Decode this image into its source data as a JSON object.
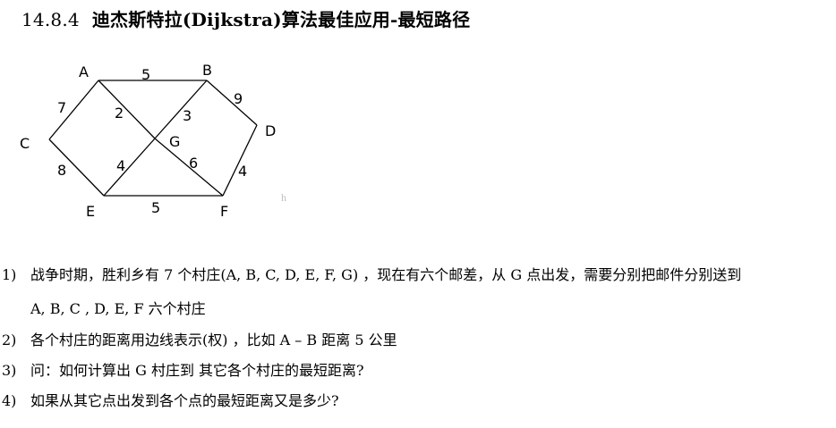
{
  "section": {
    "number": "14.8.4",
    "title": "迪杰斯特拉(Dijkstra)算法最佳应用-最短路径"
  },
  "graph": {
    "nodes": [
      {
        "id": "A",
        "label": "A"
      },
      {
        "id": "B",
        "label": "B"
      },
      {
        "id": "C",
        "label": "C"
      },
      {
        "id": "D",
        "label": "D"
      },
      {
        "id": "E",
        "label": "E"
      },
      {
        "id": "F",
        "label": "F"
      },
      {
        "id": "G",
        "label": "G"
      }
    ],
    "edges": [
      {
        "from": "A",
        "to": "B",
        "weight": "5"
      },
      {
        "from": "A",
        "to": "C",
        "weight": "7"
      },
      {
        "from": "A",
        "to": "G",
        "weight": "2"
      },
      {
        "from": "B",
        "to": "G",
        "weight": "3"
      },
      {
        "from": "B",
        "to": "D",
        "weight": "9"
      },
      {
        "from": "C",
        "to": "E",
        "weight": "8"
      },
      {
        "from": "E",
        "to": "G",
        "weight": "4"
      },
      {
        "from": "G",
        "to": "F",
        "weight": "6"
      },
      {
        "from": "D",
        "to": "F",
        "weight": "4"
      },
      {
        "from": "E",
        "to": "F",
        "weight": "5"
      }
    ],
    "watermark": "h"
  },
  "list": [
    {
      "idx": "1)",
      "text": "战争时期，胜利乡有 7 个村庄(A, B, C, D, E, F, G) ，现在有六个邮差，从 G 点出发，需要分别把邮件分别送到"
    },
    {
      "idx": "",
      "text": "A, B, C , D, E, F  六个村庄"
    },
    {
      "idx": "2)",
      "text": "各个村庄的距离用边线表示(权) ，比如 A  –  B  距离  5 公里"
    },
    {
      "idx": "3)",
      "text": "问：如何计算出 G 村庄到  其它各个村庄的最短距离?"
    },
    {
      "idx": "4)",
      "text": "如果从其它点出发到各个点的最短距离又是多少?"
    }
  ]
}
